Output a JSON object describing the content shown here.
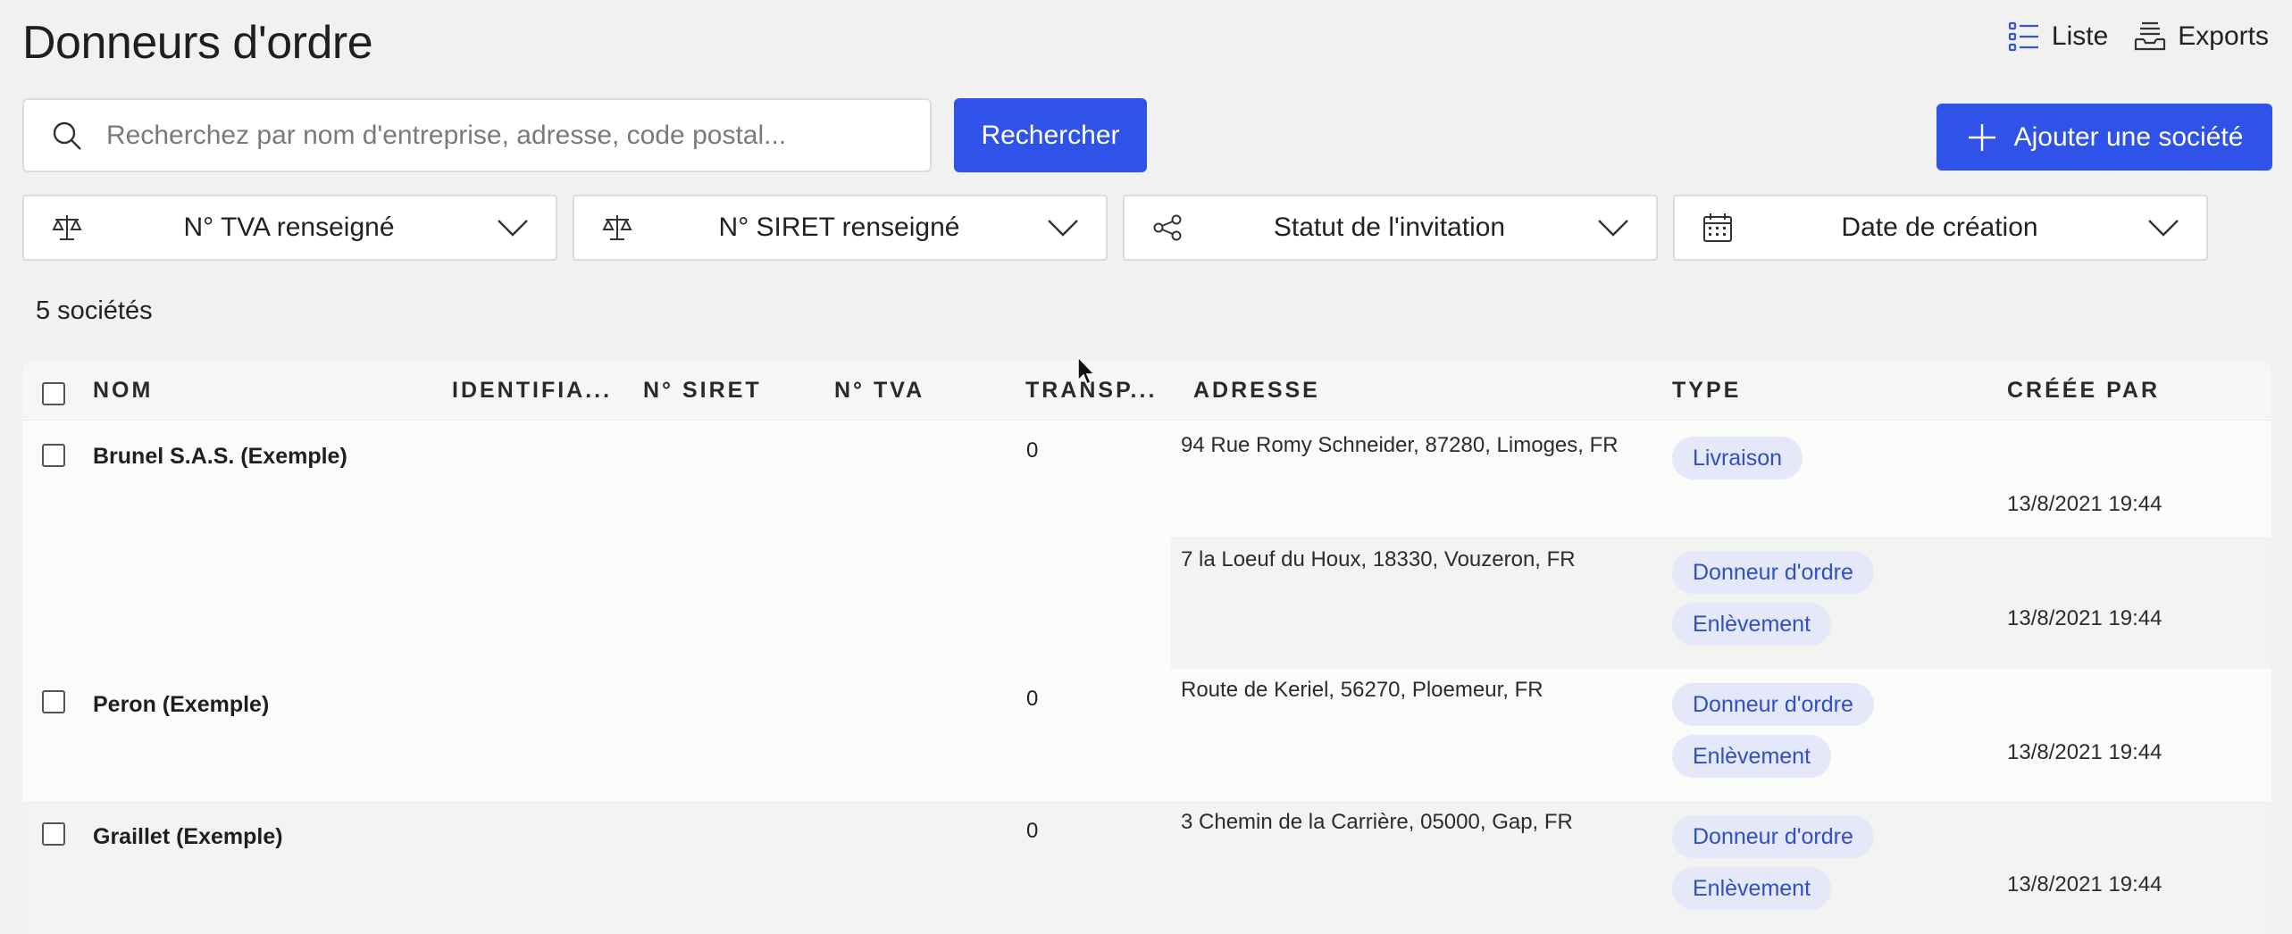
{
  "header": {
    "title": "Donneurs d'ordre",
    "links": [
      {
        "label": "Liste",
        "icon": "list-icon"
      },
      {
        "label": "Exports",
        "icon": "exports-icon"
      }
    ]
  },
  "search": {
    "placeholder": "Recherchez par nom d'entreprise, adresse, code postal...",
    "value": "",
    "button_label": "Rechercher"
  },
  "add_button_label": "Ajouter une société",
  "filters": [
    {
      "label": "N° TVA renseigné",
      "icon": "scale-icon"
    },
    {
      "label": "N° SIRET renseigné",
      "icon": "scale-icon"
    },
    {
      "label": "Statut de l'invitation",
      "icon": "share-icon"
    },
    {
      "label": "Date de création",
      "icon": "calendar-icon"
    }
  ],
  "count_label": "5 sociétés",
  "table": {
    "columns": [
      "NOM",
      "IDENTIFIA...",
      "N° SIRET",
      "N° TVA",
      "TRANSP...",
      "ADRESSE",
      "TYPE",
      "CRÉÉE PAR"
    ],
    "rows": [
      {
        "name": "Brunel S.A.S. (Exemple)",
        "transport": "0",
        "addresses": [
          {
            "address": "94 Rue Romy Schneider, 87280, Limoges, FR",
            "types": [
              "Livraison"
            ],
            "created": "13/8/2021 19:44"
          },
          {
            "address": "7 la Loeuf du Houx, 18330, Vouzeron, FR",
            "types": [
              "Donneur d'ordre",
              "Enlèvement"
            ],
            "created": "13/8/2021 19:44"
          }
        ]
      },
      {
        "name": "Peron (Exemple)",
        "transport": "0",
        "addresses": [
          {
            "address": "Route de Keriel, 56270, Ploemeur, FR",
            "types": [
              "Donneur d'ordre",
              "Enlèvement"
            ],
            "created": "13/8/2021 19:44"
          }
        ]
      },
      {
        "name": "Graillet (Exemple)",
        "transport": "0",
        "addresses": [
          {
            "address": "3 Chemin de la Carrière, 05000, Gap, FR",
            "types": [
              "Donneur d'ordre",
              "Enlèvement"
            ],
            "created": "13/8/2021 19:44"
          }
        ]
      }
    ]
  },
  "colors": {
    "primary": "#2f52e9",
    "badge_bg": "#e4e8f8",
    "badge_text": "#2f4fc4",
    "page_bg": "#f1f1f1"
  }
}
